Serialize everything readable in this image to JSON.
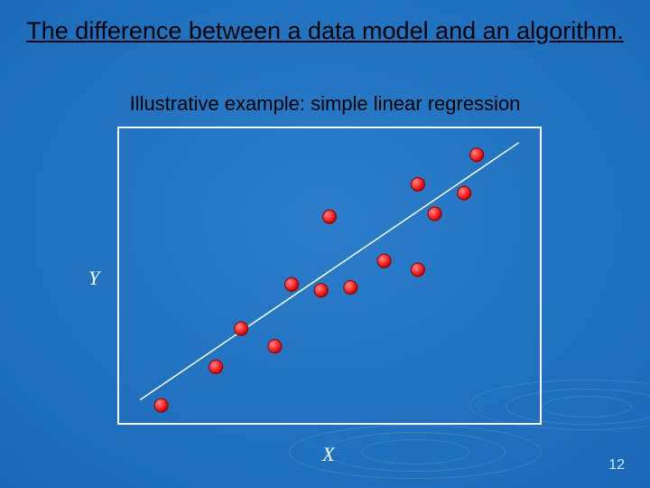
{
  "slide": {
    "title": "The difference between a data model and an algorithm.",
    "subtitle": "Illustrative example: simple linear regression",
    "page_number": "12"
  },
  "chart_data": {
    "type": "scatter",
    "title": "",
    "xlabel": "X",
    "ylabel": "Y",
    "xlim": [
      0,
      10
    ],
    "ylim": [
      0,
      10
    ],
    "series": [
      {
        "name": "points",
        "x": [
          1.0,
          2.3,
          2.9,
          3.7,
          4.1,
          4.8,
          5.5,
          6.3,
          7.1,
          7.5,
          5.0,
          7.1,
          8.2,
          8.5
        ],
        "y": [
          0.6,
          1.9,
          3.2,
          2.6,
          4.7,
          4.5,
          4.6,
          5.5,
          5.2,
          7.1,
          7.0,
          8.1,
          7.8,
          9.1
        ]
      }
    ],
    "line": {
      "slope": 0.97,
      "intercept": 0.3,
      "x_range": [
        0.5,
        9.5
      ]
    },
    "grid": false,
    "legend": false,
    "point_color": "#ff2a2a",
    "point_stroke": "#8b0000",
    "line_color": "#ffffff"
  }
}
